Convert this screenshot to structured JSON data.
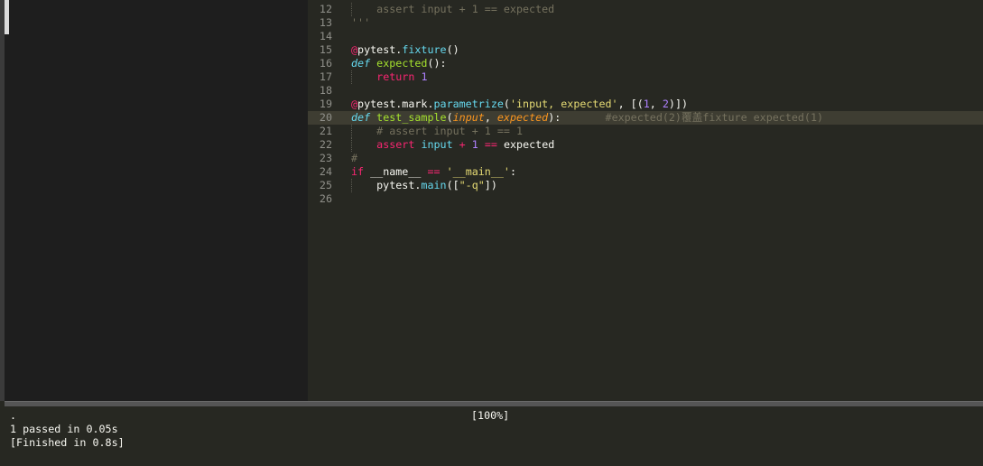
{
  "editor": {
    "active_line": "20",
    "lines": [
      {
        "num": "12",
        "tokens": [
          {
            "t": "    ",
            "c": "t-plain"
          },
          {
            "t": "assert input + 1 == expected",
            "c": "t-comment"
          }
        ]
      },
      {
        "num": "13",
        "tokens": [
          {
            "t": "'''",
            "c": "t-comment"
          }
        ]
      },
      {
        "num": "14",
        "tokens": []
      },
      {
        "num": "15",
        "tokens": [
          {
            "t": "@",
            "c": "t-key"
          },
          {
            "t": "pytest.",
            "c": "t-plain"
          },
          {
            "t": "fixture",
            "c": "t-builtin"
          },
          {
            "t": "()",
            "c": "t-plain"
          }
        ]
      },
      {
        "num": "16",
        "tokens": [
          {
            "t": "def",
            "c": "t-def"
          },
          {
            "t": " ",
            "c": "t-plain"
          },
          {
            "t": "expected",
            "c": "t-fn"
          },
          {
            "t": "():",
            "c": "t-plain"
          }
        ]
      },
      {
        "num": "17",
        "tokens": [
          {
            "t": "    ",
            "c": "t-plain"
          },
          {
            "t": "return",
            "c": "t-key"
          },
          {
            "t": " ",
            "c": "t-plain"
          },
          {
            "t": "1",
            "c": "t-num"
          }
        ]
      },
      {
        "num": "18",
        "tokens": []
      },
      {
        "num": "19",
        "tokens": [
          {
            "t": "@",
            "c": "t-key"
          },
          {
            "t": "pytest.mark.",
            "c": "t-plain"
          },
          {
            "t": "parametrize",
            "c": "t-builtin"
          },
          {
            "t": "(",
            "c": "t-plain"
          },
          {
            "t": "'input, expected'",
            "c": "t-str"
          },
          {
            "t": ", [(",
            "c": "t-plain"
          },
          {
            "t": "1",
            "c": "t-num"
          },
          {
            "t": ", ",
            "c": "t-plain"
          },
          {
            "t": "2",
            "c": "t-num"
          },
          {
            "t": ")])",
            "c": "t-plain"
          }
        ]
      },
      {
        "num": "20",
        "tokens": [
          {
            "t": "def",
            "c": "t-def"
          },
          {
            "t": " ",
            "c": "t-plain"
          },
          {
            "t": "test_sample",
            "c": "t-fn"
          },
          {
            "t": "(",
            "c": "t-plain"
          },
          {
            "t": "input",
            "c": "t-param"
          },
          {
            "t": ", ",
            "c": "t-plain"
          },
          {
            "t": "expected",
            "c": "t-param"
          },
          {
            "t": "):       ",
            "c": "t-plain"
          },
          {
            "t": "#expected(2)覆盖fixture expected(1)",
            "c": "t-comment"
          }
        ]
      },
      {
        "num": "21",
        "tokens": [
          {
            "t": "    ",
            "c": "t-plain"
          },
          {
            "t": "# assert input + 1 == 1",
            "c": "t-comment"
          }
        ]
      },
      {
        "num": "22",
        "tokens": [
          {
            "t": "    ",
            "c": "t-plain"
          },
          {
            "t": "assert",
            "c": "t-key"
          },
          {
            "t": " ",
            "c": "t-plain"
          },
          {
            "t": "input",
            "c": "t-builtin"
          },
          {
            "t": " ",
            "c": "t-plain"
          },
          {
            "t": "+",
            "c": "t-key"
          },
          {
            "t": " ",
            "c": "t-plain"
          },
          {
            "t": "1",
            "c": "t-num"
          },
          {
            "t": " ",
            "c": "t-plain"
          },
          {
            "t": "==",
            "c": "t-key"
          },
          {
            "t": " expected",
            "c": "t-plain"
          }
        ]
      },
      {
        "num": "23",
        "tokens": [
          {
            "t": "#",
            "c": "t-comment"
          }
        ]
      },
      {
        "num": "24",
        "tokens": [
          {
            "t": "if",
            "c": "t-key"
          },
          {
            "t": " __name__ ",
            "c": "t-plain"
          },
          {
            "t": "==",
            "c": "t-key"
          },
          {
            "t": " ",
            "c": "t-plain"
          },
          {
            "t": "'__main__'",
            "c": "t-str"
          },
          {
            "t": ":",
            "c": "t-plain"
          }
        ]
      },
      {
        "num": "25",
        "tokens": [
          {
            "t": "    pytest.",
            "c": "t-plain"
          },
          {
            "t": "main",
            "c": "t-builtin"
          },
          {
            "t": "([",
            "c": "t-plain"
          },
          {
            "t": "\"-q\"",
            "c": "t-str"
          },
          {
            "t": "])",
            "c": "t-plain"
          }
        ]
      },
      {
        "num": "26",
        "tokens": []
      }
    ]
  },
  "output": {
    "lines": [
      ".",
      "1 passed in 0.05s",
      "[Finished in 0.8s]"
    ],
    "progress": "[100%]"
  }
}
